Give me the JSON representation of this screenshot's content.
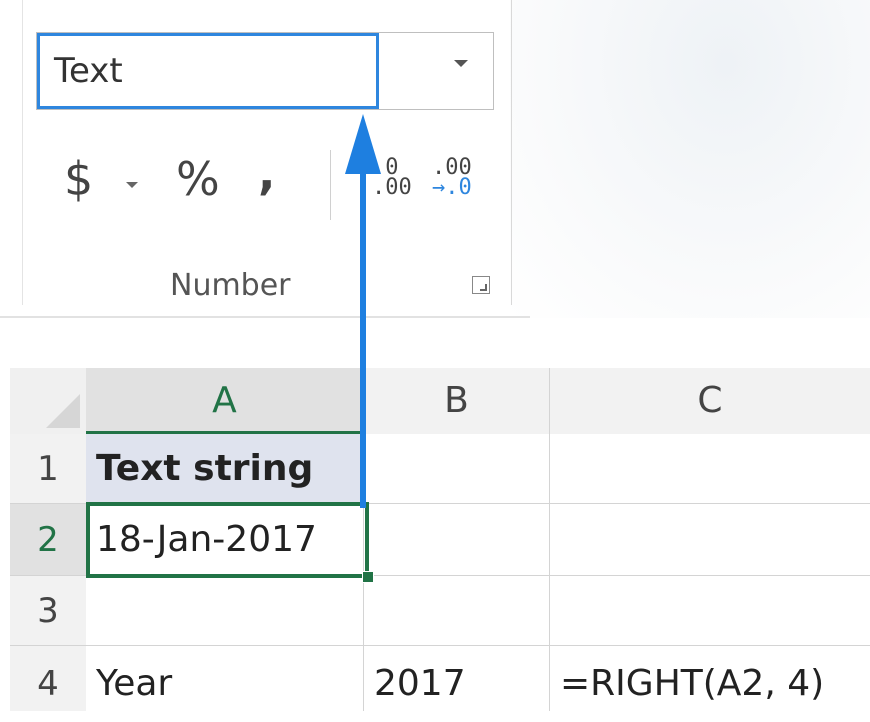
{
  "number_format": {
    "value": "Text",
    "group_label": "Number",
    "currency_symbol": "$",
    "percent_symbol": "%",
    "comma_symbol": ",",
    "increase_decimal": {
      "top": ".0",
      "bottom": ".00"
    },
    "decrease_decimal": {
      "top": ".00",
      "bottom": "→.0"
    }
  },
  "sheet": {
    "columns": [
      "A",
      "B",
      "C"
    ],
    "rows": [
      {
        "num": "1",
        "cells": [
          "Text string",
          "",
          ""
        ]
      },
      {
        "num": "2",
        "cells": [
          "18-Jan-2017",
          "",
          ""
        ]
      },
      {
        "num": "3",
        "cells": [
          "",
          "",
          ""
        ]
      },
      {
        "num": "4",
        "cells": [
          "Year",
          "2017",
          "=RIGHT(A2, 4)"
        ]
      }
    ],
    "active_cell": "A2"
  },
  "colors": {
    "accent_blue": "#1e7fe0",
    "excel_green": "#217346"
  }
}
